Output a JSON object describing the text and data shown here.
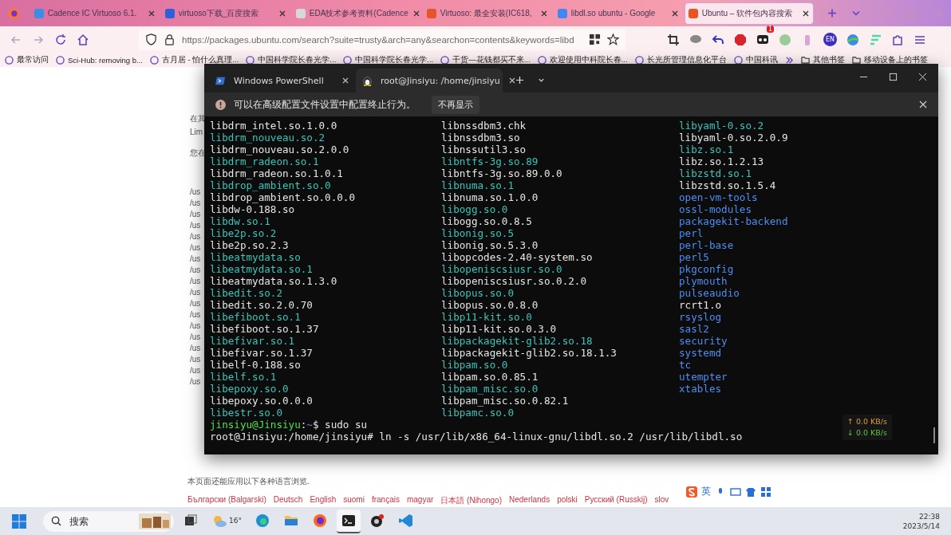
{
  "browser": {
    "tabs": [
      {
        "title": "Cadence IC Virtuoso 6.1.",
        "selected": false,
        "color": "#3a8ee6"
      },
      {
        "title": "virtuoso下载_百度搜索",
        "selected": false,
        "color": "#2d5fd8"
      },
      {
        "title": "EDA技术参考资料(Cadence",
        "selected": false,
        "color": "#d8d8d8"
      },
      {
        "title": "Virtuoso: 最全安装(IC618,",
        "selected": false,
        "color": "#e8542a"
      },
      {
        "title": "libdl.so ubuntu - Google",
        "selected": false,
        "color": "#4285f4"
      },
      {
        "title": "Ubuntu – 软件包内容搜索",
        "selected": true,
        "color": "#e95420"
      }
    ],
    "url": "https://packages.ubuntu.com/search?suite=trusty&arch=any&searchon=contents&keywords=libd",
    "extension_badge": "1",
    "language_badge": "EN",
    "bookmarks": [
      {
        "label": "最常访问"
      },
      {
        "label": "Sci-Hub: removing b..."
      },
      {
        "label": "古月居 - 怕什么真理..."
      },
      {
        "label": "中国科学院长春光学..."
      },
      {
        "label": "中国科学院长春光学..."
      },
      {
        "label": "干货—花钱都买不来..."
      },
      {
        "label": "欢迎使用中科院长春..."
      },
      {
        "label": "长光所管理信息化平台"
      },
      {
        "label": "中国科讯"
      }
    ],
    "other_bookmarks": [
      {
        "label": "其他书签"
      },
      {
        "label": "移动设备上的书签"
      }
    ]
  },
  "page": {
    "fragments": [
      "在其",
      "Lim",
      "您在"
    ],
    "paths": [
      "/us",
      "/us",
      "/us",
      "/us",
      "/us",
      "/us",
      "/us",
      "/us",
      "/us",
      "/us",
      "/us",
      "/us",
      "/us",
      "/us",
      "/us",
      "/us",
      "/us",
      "/us"
    ],
    "languages_note": "本页面还能应用以下各种语言浏览.",
    "languages": [
      "Български (Balgarski)",
      "Deutsch",
      "English",
      "suomi",
      "français",
      "magyar",
      "日本語 (Nihongo)",
      "Nederlands",
      "polski",
      "Русский (Russkij)",
      "slov"
    ]
  },
  "terminal": {
    "tabs": [
      {
        "title": "Windows PowerShell",
        "kind": "powershell",
        "selected": false
      },
      {
        "title": "root@Jinsiyu: /home/jinsiyu",
        "kind": "linux",
        "selected": true
      }
    ],
    "notice": {
      "text": "可以在高级配置文件设置中配置终止行为。",
      "button": "不再显示"
    },
    "columns": [
      [
        {
          "name": "libdrm_intel.so.1.0.0",
          "kind": "file"
        },
        {
          "name": "libdrm_nouveau.so.2",
          "kind": "link"
        },
        {
          "name": "libdrm_nouveau.so.2.0.0",
          "kind": "file"
        },
        {
          "name": "libdrm_radeon.so.1",
          "kind": "link"
        },
        {
          "name": "libdrm_radeon.so.1.0.1",
          "kind": "file"
        },
        {
          "name": "libdrop_ambient.so.0",
          "kind": "link"
        },
        {
          "name": "libdrop_ambient.so.0.0.0",
          "kind": "file"
        },
        {
          "name": "libdw-0.188.so",
          "kind": "file"
        },
        {
          "name": "libdw.so.1",
          "kind": "link"
        },
        {
          "name": "libe2p.so.2",
          "kind": "link"
        },
        {
          "name": "libe2p.so.2.3",
          "kind": "file"
        },
        {
          "name": "libeatmydata.so",
          "kind": "link"
        },
        {
          "name": "libeatmydata.so.1",
          "kind": "link"
        },
        {
          "name": "libeatmydata.so.1.3.0",
          "kind": "file"
        },
        {
          "name": "libedit.so.2",
          "kind": "link"
        },
        {
          "name": "libedit.so.2.0.70",
          "kind": "file"
        },
        {
          "name": "libefiboot.so.1",
          "kind": "link"
        },
        {
          "name": "libefiboot.so.1.37",
          "kind": "file"
        },
        {
          "name": "libefivar.so.1",
          "kind": "link"
        },
        {
          "name": "libefivar.so.1.37",
          "kind": "file"
        },
        {
          "name": "libelf-0.188.so",
          "kind": "file"
        },
        {
          "name": "libelf.so.1",
          "kind": "link"
        },
        {
          "name": "libepoxy.so.0",
          "kind": "link"
        },
        {
          "name": "libepoxy.so.0.0.0",
          "kind": "file"
        },
        {
          "name": "libestr.so.0",
          "kind": "link"
        }
      ],
      [
        {
          "name": "libnssdbm3.chk",
          "kind": "file"
        },
        {
          "name": "libnssdbm3.so",
          "kind": "file"
        },
        {
          "name": "libnssutil3.so",
          "kind": "file"
        },
        {
          "name": "libntfs-3g.so.89",
          "kind": "link"
        },
        {
          "name": "libntfs-3g.so.89.0.0",
          "kind": "file"
        },
        {
          "name": "libnuma.so.1",
          "kind": "link"
        },
        {
          "name": "libnuma.so.1.0.0",
          "kind": "file"
        },
        {
          "name": "libogg.so.0",
          "kind": "link"
        },
        {
          "name": "libogg.so.0.8.5",
          "kind": "file"
        },
        {
          "name": "libonig.so.5",
          "kind": "link"
        },
        {
          "name": "libonig.so.5.3.0",
          "kind": "file"
        },
        {
          "name": "libopcodes-2.40-system.so",
          "kind": "file"
        },
        {
          "name": "libopeniscsiusr.so.0",
          "kind": "link"
        },
        {
          "name": "libopeniscsiusr.so.0.2.0",
          "kind": "file"
        },
        {
          "name": "libopus.so.0",
          "kind": "link"
        },
        {
          "name": "libopus.so.0.8.0",
          "kind": "file"
        },
        {
          "name": "libp11-kit.so.0",
          "kind": "link"
        },
        {
          "name": "libp11-kit.so.0.3.0",
          "kind": "file"
        },
        {
          "name": "libpackagekit-glib2.so.18",
          "kind": "link"
        },
        {
          "name": "libpackagekit-glib2.so.18.1.3",
          "kind": "file"
        },
        {
          "name": "libpam.so.0",
          "kind": "link"
        },
        {
          "name": "libpam.so.0.85.1",
          "kind": "file"
        },
        {
          "name": "libpam_misc.so.0",
          "kind": "link"
        },
        {
          "name": "libpam_misc.so.0.82.1",
          "kind": "file"
        },
        {
          "name": "libpamc.so.0",
          "kind": "link"
        }
      ],
      [
        {
          "name": "libyaml-0.so.2",
          "kind": "link"
        },
        {
          "name": "libyaml-0.so.2.0.9",
          "kind": "file"
        },
        {
          "name": "libz.so.1",
          "kind": "link"
        },
        {
          "name": "libz.so.1.2.13",
          "kind": "file"
        },
        {
          "name": "libzstd.so.1",
          "kind": "link"
        },
        {
          "name": "libzstd.so.1.5.4",
          "kind": "file"
        },
        {
          "name": "open-vm-tools",
          "kind": "dir"
        },
        {
          "name": "ossl-modules",
          "kind": "dir"
        },
        {
          "name": "packagekit-backend",
          "kind": "dir"
        },
        {
          "name": "perl",
          "kind": "dir"
        },
        {
          "name": "perl-base",
          "kind": "dir"
        },
        {
          "name": "perl5",
          "kind": "dir"
        },
        {
          "name": "pkgconfig",
          "kind": "dir"
        },
        {
          "name": "plymouth",
          "kind": "dir"
        },
        {
          "name": "pulseaudio",
          "kind": "dir"
        },
        {
          "name": "rcrt1.o",
          "kind": "file"
        },
        {
          "name": "rsyslog",
          "kind": "dir"
        },
        {
          "name": "sasl2",
          "kind": "dir"
        },
        {
          "name": "security",
          "kind": "dir"
        },
        {
          "name": "systemd",
          "kind": "dir"
        },
        {
          "name": "tc",
          "kind": "dir"
        },
        {
          "name": "utempter",
          "kind": "dir"
        },
        {
          "name": "xtables",
          "kind": "dir"
        }
      ]
    ],
    "prompt_lines": [
      [
        {
          "text": "jinsiyu@Jinsiyu",
          "kind": "user"
        },
        {
          "text": ":",
          "kind": "plain"
        },
        {
          "text": "~",
          "kind": "path"
        },
        {
          "text": "$ sudo su",
          "kind": "plain"
        }
      ],
      [
        {
          "text": "root@Jinsiyu:/home/jinsiyu# ln -s /usr/lib/x86_64-linux-gnu/libdl.so.2 /usr/lib/libdl.so",
          "kind": "plain"
        }
      ]
    ],
    "net_speed": {
      "up": "↑ 0.0 KB/s",
      "down": "↓ 0.0 KB/s"
    }
  },
  "ime_bar": {
    "mode": "英"
  },
  "taskbar": {
    "search_placeholder": "搜索",
    "weather": "16°",
    "apps": [
      {
        "kind": "taskview",
        "active": false
      },
      {
        "kind": "weather",
        "active": false
      },
      {
        "kind": "edge",
        "active": false
      },
      {
        "kind": "files",
        "active": false
      },
      {
        "kind": "firefox",
        "active": false
      },
      {
        "kind": "terminal",
        "active": true
      },
      {
        "kind": "obs",
        "active": false
      },
      {
        "kind": "vscode",
        "active": false
      }
    ],
    "time": "22:38",
    "date": "2023/5/14"
  }
}
